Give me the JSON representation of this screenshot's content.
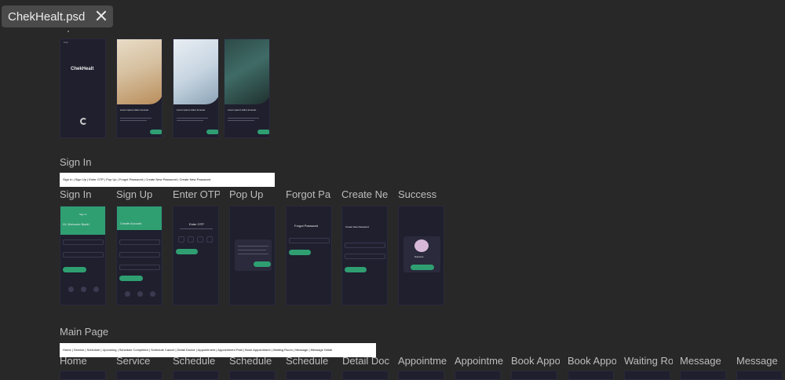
{
  "tab": {
    "title": "ChekHealt.psd"
  },
  "onboarding": {
    "splash_logo": "ChekHealt",
    "slides": [
      {
        "title": "Lorem ipsum dolor sit amet",
        "image": "beige"
      },
      {
        "title": "Lorem ipsum dolor sit amet",
        "image": "steth"
      },
      {
        "title": "Lorem ipsum dolor sit amet",
        "image": "surg"
      }
    ]
  },
  "signin_section": {
    "title": "Sign In",
    "flow_label": "Sign In | Sign Up | Enter OTP | Pop Up | Forgot Password | Create New Password | Create New Password",
    "frames": [
      {
        "label": "Sign In"
      },
      {
        "label": "Sign Up"
      },
      {
        "label": "Enter OTP"
      },
      {
        "label": "Pop Up"
      },
      {
        "label": "Forgot Pa"
      },
      {
        "label": "Create Ne"
      },
      {
        "label": "Success"
      }
    ],
    "texts": {
      "signin_header": "Sign In",
      "signin_welcome": "Hi, Welcome Back!",
      "signup_header": "Create Account",
      "otp_title": "Enter OTP",
      "forgot_title": "Forgot Password",
      "create_title": "Create New Password",
      "success_title": "Success"
    }
  },
  "main_section": {
    "title": "Main Page",
    "flow_label": "Home | Service | Schedule | Upcoming | Schedule Completed | Schedule Cancel | Detail Doctor | Appointment | Appointment Paid | Book Appointment | Waiting Room | Message | Message Detail",
    "frames": [
      {
        "label": "Home"
      },
      {
        "label": "Service"
      },
      {
        "label": "Schedule"
      },
      {
        "label": "Schedule"
      },
      {
        "label": "Schedule"
      },
      {
        "label": "Detail Doc"
      },
      {
        "label": "Appointme"
      },
      {
        "label": "Appointme"
      },
      {
        "label": "Book Appo"
      },
      {
        "label": "Book Appo"
      },
      {
        "label": "Waiting Ro"
      },
      {
        "label": "Message"
      },
      {
        "label": "Message"
      }
    ]
  },
  "colors": {
    "background": "#282828",
    "tab": "#4a4a4a",
    "screen": "#1f1f2e",
    "accent": "#2f9f72"
  }
}
